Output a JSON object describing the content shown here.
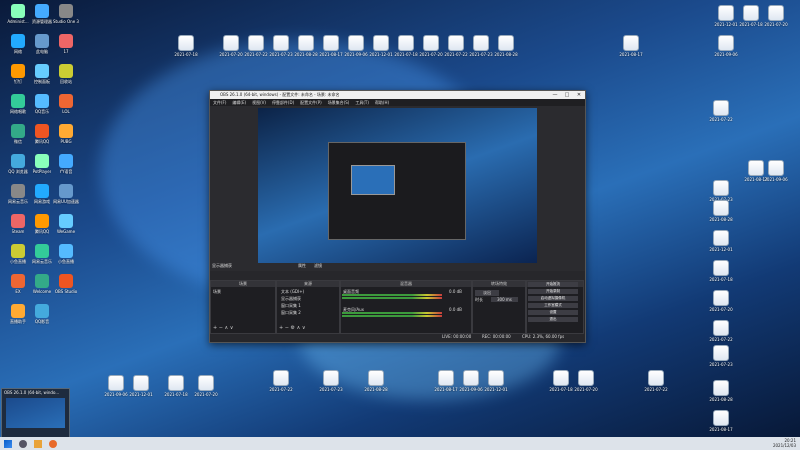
{
  "desktop": {
    "left_icons": [
      {
        "label": "Administ..."
      },
      {
        "label": "资源管理器"
      },
      {
        "label": "Studio One 3"
      },
      {
        "label": "网络"
      },
      {
        "label": "此电脑"
      },
      {
        "label": "17"
      },
      {
        "label": "钉钉"
      },
      {
        "label": "控制面板"
      },
      {
        "label": "回收站"
      },
      {
        "label": "网络唱歌"
      },
      {
        "label": "QQ音乐"
      },
      {
        "label": "LOL"
      },
      {
        "label": "微信"
      },
      {
        "label": "腾讯QQ"
      },
      {
        "label": "PUBG"
      },
      {
        "label": "QQ 浏览器"
      },
      {
        "label": "PotPlayer"
      },
      {
        "label": "YY语音"
      },
      {
        "label": "网易云音乐"
      },
      {
        "label": "网易游戏"
      },
      {
        "label": "网易UU加速器"
      },
      {
        "label": "Steam"
      },
      {
        "label": "腾讯QQ"
      },
      {
        "label": "WeGame"
      },
      {
        "label": "小鱼直播"
      },
      {
        "label": "网易云音乐"
      },
      {
        "label": "小鱼直播"
      },
      {
        "label": "EX"
      },
      {
        "label": "Welcome"
      },
      {
        "label": "OBS Studio"
      },
      {
        "label": "直播助手"
      },
      {
        "label": "QQ影音"
      }
    ],
    "file_labels": [
      "2021-07-18",
      "2021-07-20",
      "2021-07-22",
      "2021-07-23",
      "2021-08-28",
      "2021-08-17",
      "2021-09-06",
      "2021-12-01"
    ]
  },
  "obs": {
    "title": "OBS 26.1.0 (64-bit, windows) - 配置文件: 未命名 - 场景: 未命名",
    "menu": [
      "文件(F)",
      "编辑(E)",
      "视图(V)",
      "停靠部件(D)",
      "配置文件(P)",
      "场景集合(S)",
      "工具(T)",
      "帮助(H)"
    ],
    "below_labels": {
      "active_source": "显示器捕获",
      "properties": "属性",
      "filters": "滤镜"
    },
    "panels": {
      "scenes": {
        "title": "场景",
        "items": [
          "场景"
        ]
      },
      "sources": {
        "title": "来源",
        "items": [
          "文本 (GDI+)",
          "显示器捕获",
          "窗口采集 1",
          "窗口采集 2"
        ]
      },
      "mixer": {
        "title": "混音器",
        "tracks": [
          {
            "name": "桌面音频",
            "db": "0.0 dB"
          },
          {
            "name": "麦克风/Aux",
            "db": "0.0 dB"
          }
        ]
      },
      "transitions": {
        "title": "转场特效",
        "type": "淡出",
        "duration_label": "时长",
        "duration": "300 ms"
      },
      "controls": {
        "title": "控件",
        "buttons": [
          "开始推流",
          "开始录制",
          "启动虚拟摄像机",
          "工作室模式",
          "设置",
          "退出"
        ]
      }
    },
    "status": {
      "live": "LIVE: 00:00:00",
      "rec": "REC: 00:00:00",
      "cpu": "CPU: 2.3%, 60.00 fps"
    }
  },
  "taskbar": {
    "thumb_title": "OBS 26.1.0 (64-bit, windo...",
    "time": "20:21",
    "date": "2021/12/03"
  }
}
